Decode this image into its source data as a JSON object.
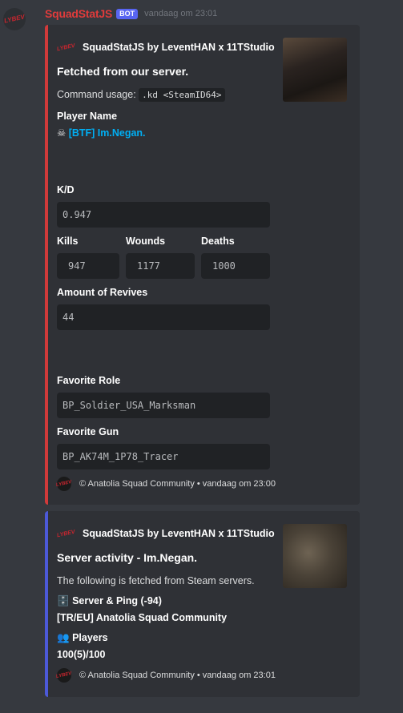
{
  "message": {
    "avatar_text": "LYBEV",
    "username": "SquadStatJS",
    "bot_tag": "BOT",
    "timestamp": "vandaag om 23:01"
  },
  "embed1": {
    "author": "SquadStatJS by LeventHAN x 11TStudio",
    "author_icon_text": "LYBEV",
    "title": "Fetched from our server.",
    "command_label": "Command usage:",
    "command": ".kd <SteamID64>",
    "player_name_label": "Player Name",
    "player_icon": "☠",
    "player_name": "[BTF] Im.Negan.",
    "kd_label": "K/D",
    "kd_value": "0.947",
    "kills_label": "Kills",
    "kills_value": "947",
    "wounds_label": "Wounds",
    "wounds_value": "1177",
    "deaths_label": "Deaths",
    "deaths_value": "1000",
    "revives_label": "Amount of Revives",
    "revives_value": "44",
    "role_label": "Favorite Role",
    "role_value": "BP_Soldier_USA_Marksman",
    "gun_label": "Favorite Gun",
    "gun_value": "BP_AK74M_1P78_Tracer",
    "footer_icon_text": "LYBEV",
    "footer": "© Anatolia Squad Community • vandaag om 23:00"
  },
  "embed2": {
    "author": "SquadStatJS by LeventHAN x 11TStudio",
    "author_icon_text": "LYBEV",
    "title": "Server activity - Im.Negan.",
    "description": "The following is fetched from Steam servers.",
    "server_icon": "🗄️",
    "server_label": "Server & Ping (-94)",
    "server_value": "[TR/EU] Anatolia Squad Community",
    "players_icon": "👥",
    "players_label": "Players",
    "players_value": "100(5)/100",
    "footer_icon_text": "LYBEV",
    "footer": "© Anatolia Squad Community • vandaag om 23:01"
  },
  "colors": {
    "embed1_accent": "#d13a3a",
    "embed2_accent": "#4c59d8",
    "username": "#e03b3b",
    "link": "#00aff4"
  }
}
